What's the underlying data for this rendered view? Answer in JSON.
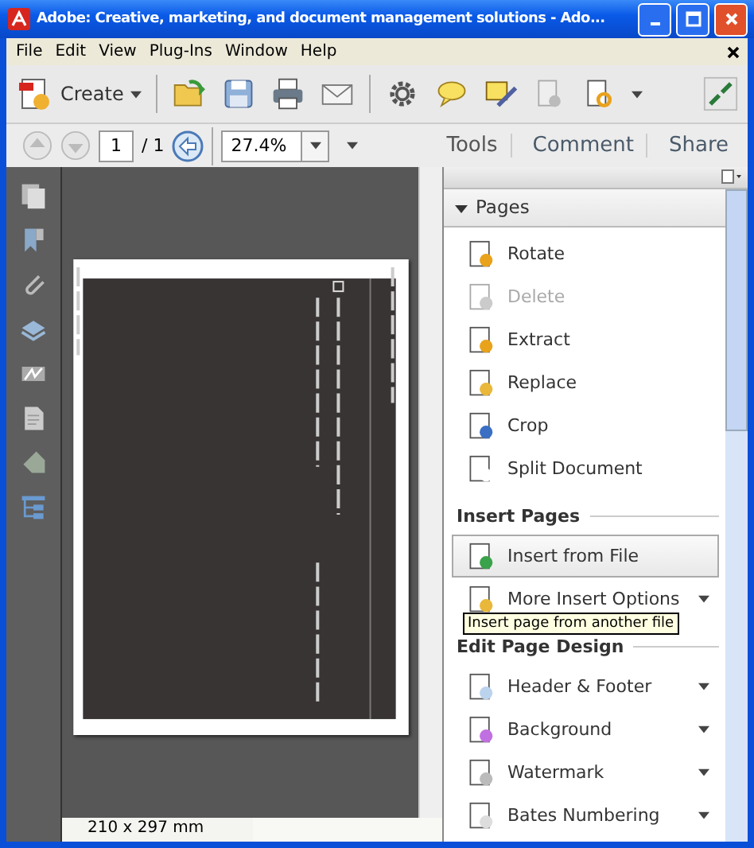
{
  "window": {
    "title": "Adobe: Creative, marketing, and document management solutions - Ado..."
  },
  "menu": [
    "File",
    "Edit",
    "View",
    "Plug-Ins",
    "Window",
    "Help"
  ],
  "toolbar": {
    "create_label": "Create"
  },
  "nav": {
    "page": "1",
    "page_count": "/ 1",
    "zoom": "27.4%"
  },
  "task_tabs": [
    "Tools",
    "Comment",
    "Share"
  ],
  "document": {
    "page_size": "210 x 297 mm"
  },
  "panel": {
    "sections": [
      {
        "kind": "header",
        "title": "Pages",
        "expanded": true,
        "items": [
          {
            "label": "Rotate",
            "disabled": false,
            "highlighted": false,
            "has_menu": false
          },
          {
            "label": "Delete",
            "disabled": true,
            "highlighted": false,
            "has_menu": false
          },
          {
            "label": "Extract",
            "disabled": false,
            "highlighted": false,
            "has_menu": false
          },
          {
            "label": "Replace",
            "disabled": false,
            "highlighted": false,
            "has_menu": false
          },
          {
            "label": "Crop",
            "disabled": false,
            "highlighted": false,
            "has_menu": false
          },
          {
            "label": "Split Document",
            "disabled": false,
            "highlighted": false,
            "has_menu": false
          }
        ]
      },
      {
        "kind": "group",
        "title": "Insert Pages",
        "items": [
          {
            "label": "Insert from File",
            "disabled": false,
            "highlighted": true,
            "has_menu": false
          },
          {
            "label": "More Insert Options",
            "disabled": false,
            "highlighted": false,
            "has_menu": true
          }
        ]
      },
      {
        "kind": "group",
        "title": "Edit Page Design",
        "items": [
          {
            "label": "Header & Footer",
            "disabled": false,
            "highlighted": false,
            "has_menu": true
          },
          {
            "label": "Background",
            "disabled": false,
            "highlighted": false,
            "has_menu": true
          },
          {
            "label": "Watermark",
            "disabled": false,
            "highlighted": false,
            "has_menu": true
          },
          {
            "label": "Bates Numbering",
            "disabled": false,
            "highlighted": false,
            "has_menu": true
          }
        ]
      }
    ]
  },
  "tooltip": {
    "text": "Insert page from another file"
  }
}
